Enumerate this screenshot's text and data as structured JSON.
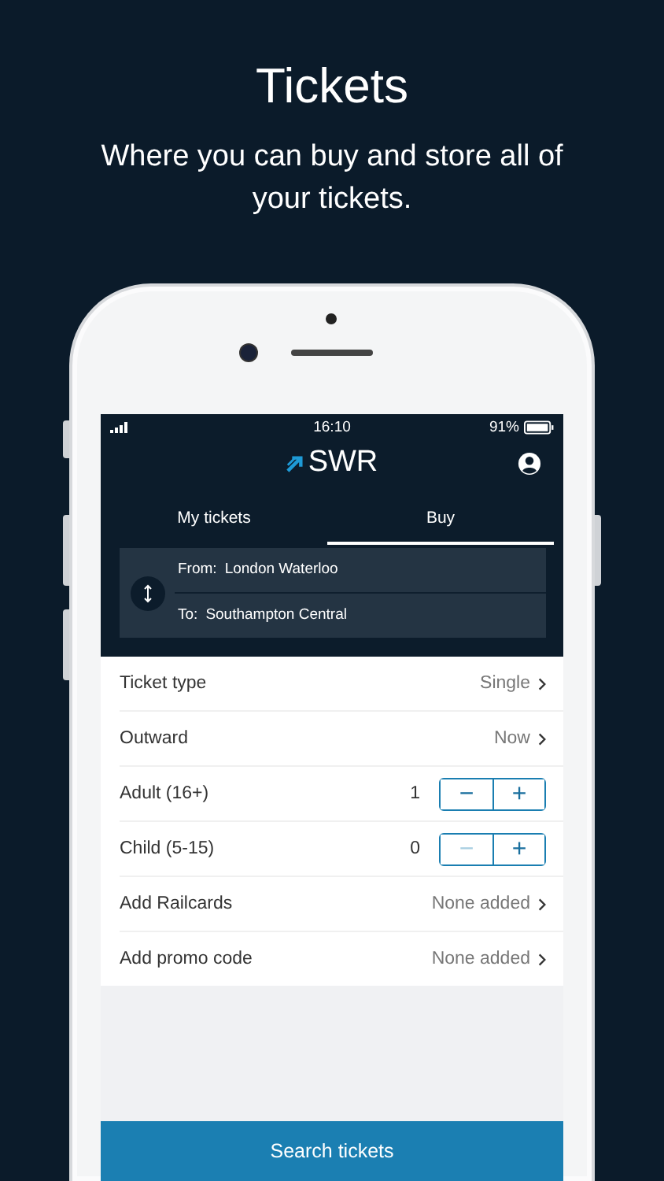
{
  "heading": "Tickets",
  "subheading": "Where you can buy and store all of your tickets.",
  "status_bar": {
    "time": "16:10",
    "battery": "91%"
  },
  "app_bar": {
    "logo": "SWR"
  },
  "tabs": [
    {
      "label": "My tickets",
      "selected": false
    },
    {
      "label": "Buy",
      "selected": true
    }
  ],
  "route": {
    "from_label": "From:",
    "from": "London Waterloo",
    "to_label": "To:",
    "to": "Southampton Central"
  },
  "rows": [
    {
      "kind": "select",
      "label": "Ticket type",
      "value": "Single"
    },
    {
      "kind": "select",
      "label": "Outward",
      "value": "Now"
    },
    {
      "kind": "stepper",
      "label": "Adult (16+)",
      "value": "1",
      "minus_disabled": false,
      "minus": "−",
      "plus": "+"
    },
    {
      "kind": "stepper",
      "label": "Child (5-15)",
      "value": "0",
      "minus_disabled": true,
      "minus": "−",
      "plus": "+"
    },
    {
      "kind": "select",
      "label": "Add Railcards",
      "value": "None added"
    },
    {
      "kind": "select",
      "label": "Add promo code",
      "value": "None added"
    }
  ],
  "search_button": "Search tickets"
}
